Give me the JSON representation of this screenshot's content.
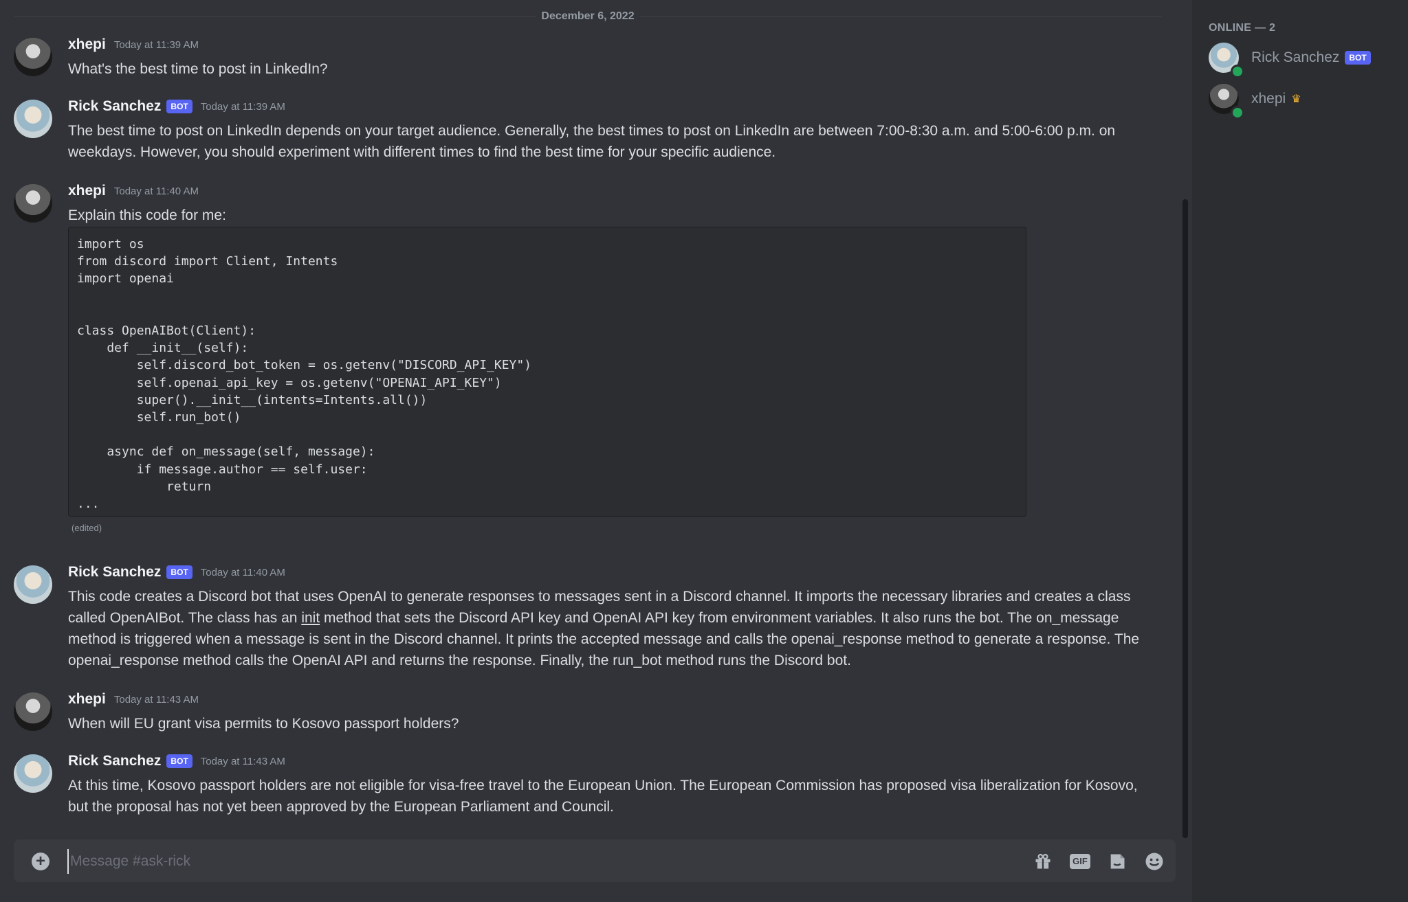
{
  "date_divider": "December 6, 2022",
  "messages": [
    {
      "author": "xhepi",
      "timestamp": "Today at 11:39 AM",
      "text": "What's the best time to post in LinkedIn?"
    },
    {
      "author": "Rick Sanchez",
      "badge": "BOT",
      "timestamp": "Today at 11:39 AM",
      "text": "The best time to post on LinkedIn depends on your target audience. Generally, the best times to post on LinkedIn are between 7:00-8:30 a.m. and 5:00-6:00 p.m. on weekdays. However, you should experiment with different times to find the best time for your specific audience."
    },
    {
      "author": "xhepi",
      "timestamp": "Today at 11:40 AM",
      "text": "Explain this code for me:",
      "code": "import os\nfrom discord import Client, Intents\nimport openai\n\n\nclass OpenAIBot(Client):\n    def __init__(self):\n        self.discord_bot_token = os.getenv(\"DISCORD_API_KEY\")\n        self.openai_api_key = os.getenv(\"OPENAI_API_KEY\")\n        super().__init__(intents=Intents.all())\n        self.run_bot()\n\n    async def on_message(self, message):\n        if message.author == self.user:\n            return\n...",
      "edited": "(edited)"
    },
    {
      "author": "Rick Sanchez",
      "badge": "BOT",
      "timestamp": "Today at 11:40 AM",
      "text_before": "This code creates a Discord bot that uses OpenAI to generate responses to messages sent in a Discord channel. It imports the necessary libraries and creates a class called OpenAIBot. The class has an ",
      "text_link": "init",
      "text_after": " method that sets the Discord API key and OpenAI API key from environment variables. It also runs the bot. The on_message method is triggered when a message is sent in the Discord channel. It prints the accepted message and calls the openai_response method to generate a response. The openai_response method calls the OpenAI API and returns the response. Finally, the run_bot method runs the Discord bot."
    },
    {
      "author": "xhepi",
      "timestamp": "Today at 11:43 AM",
      "text": "When will EU grant visa permits to Kosovo passport holders?"
    },
    {
      "author": "Rick Sanchez",
      "badge": "BOT",
      "timestamp": "Today at 11:43 AM",
      "text": "At this time, Kosovo passport holders are not eligible for visa-free travel to the European Union. The European Commission has proposed visa liberalization for Kosovo, but the proposal has not yet been approved by the European Parliament and Council."
    }
  ],
  "composer": {
    "placeholder": "Message #ask-rick",
    "icons": [
      "plus-circle-icon",
      "gift-icon",
      "gif-icon",
      "sticker-icon",
      "emoji-icon"
    ],
    "gif_label": "GIF"
  },
  "members": {
    "header": "ONLINE — 2",
    "list": [
      {
        "name": "Rick Sanchez",
        "badge": "BOT",
        "status": "online"
      },
      {
        "name": "xhepi",
        "badge_icon": "crown-icon",
        "status": "online"
      }
    ]
  },
  "colors": {
    "background": "#313338",
    "sidebar": "#2b2d31",
    "bot_badge": "#5865f2",
    "online": "#23a55a",
    "crown": "#f0b232"
  }
}
